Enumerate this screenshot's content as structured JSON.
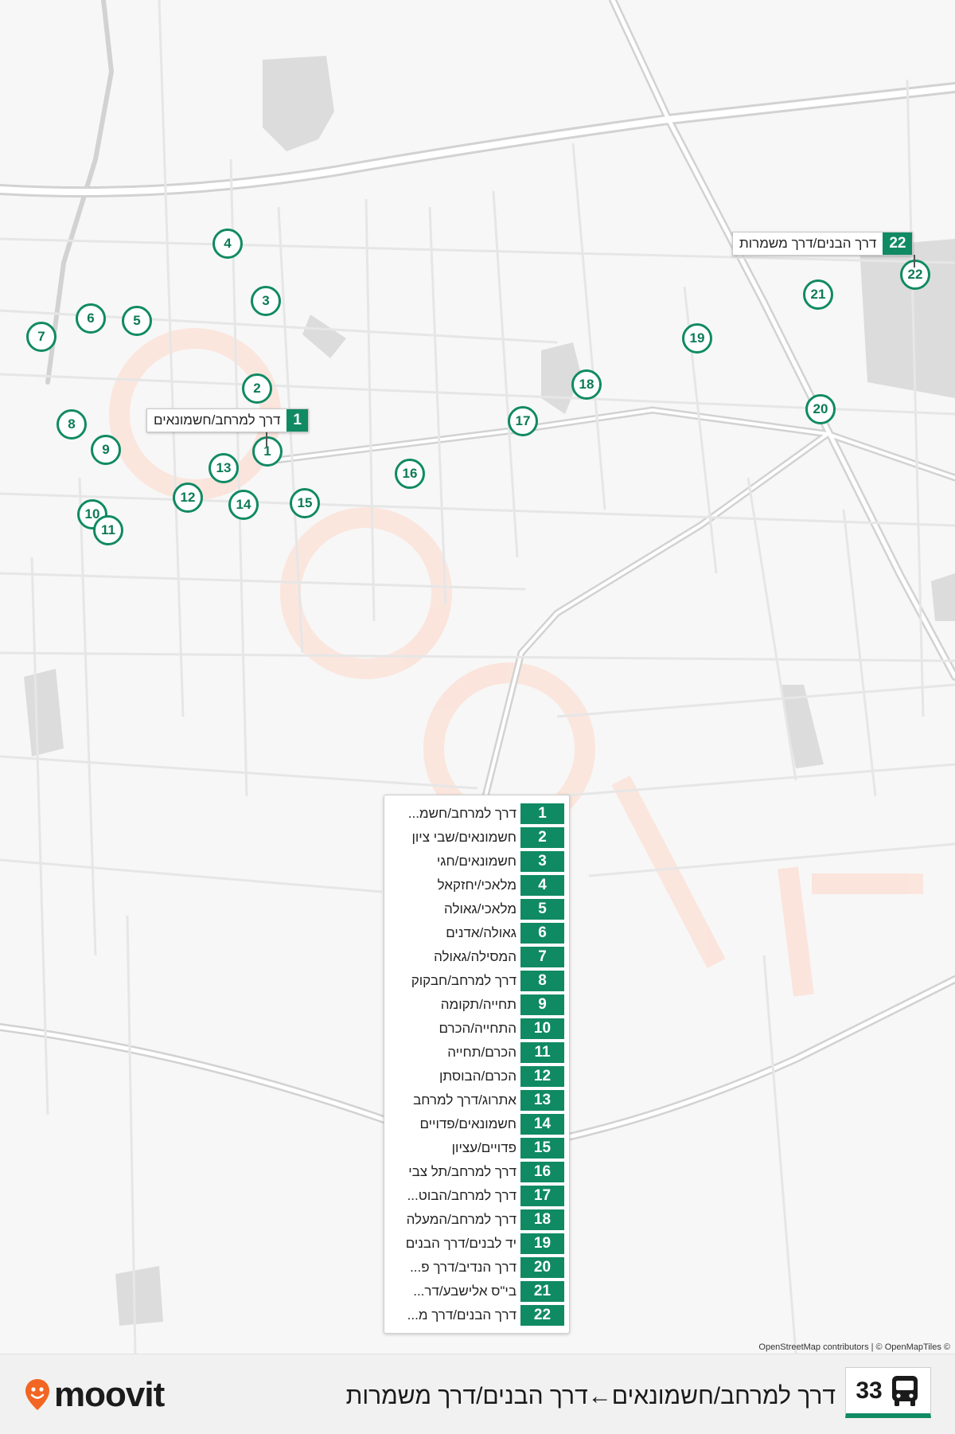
{
  "route": {
    "number": "33",
    "title": "דרך למרחב/חשמונאים←דרך הבנים/דרך משמרות"
  },
  "brand": {
    "name": "moovit",
    "accent": "#108a63",
    "logo_color": "#f26522"
  },
  "attribution": "OpenStreetMap contributors | © OpenMapTiles ©",
  "callouts": {
    "start": {
      "number": "1",
      "name": "דרך למרחב/חשמונאים"
    },
    "end": {
      "number": "22",
      "name": "דרך הבנים/דרך משמרות"
    }
  },
  "stops": [
    {
      "number": "1",
      "name": "דרך למרחב/חשמ..."
    },
    {
      "number": "2",
      "name": "חשמונאים/שבי ציון"
    },
    {
      "number": "3",
      "name": "חשמונאים/חגי"
    },
    {
      "number": "4",
      "name": "מלאכי/יחזקאל"
    },
    {
      "number": "5",
      "name": "מלאכי/גאולה"
    },
    {
      "number": "6",
      "name": "גאולה/אדנים"
    },
    {
      "number": "7",
      "name": "המסילה/גאולה"
    },
    {
      "number": "8",
      "name": "דרך למרחב/חבקוק"
    },
    {
      "number": "9",
      "name": "תחייה/תקומה"
    },
    {
      "number": "10",
      "name": "התחייה/הכרם"
    },
    {
      "number": "11",
      "name": "הכרם/תחייה"
    },
    {
      "number": "12",
      "name": "הכרם/הבוסתן"
    },
    {
      "number": "13",
      "name": "אתרוג/דרך למרחב"
    },
    {
      "number": "14",
      "name": "חשמונאים/פדויים"
    },
    {
      "number": "15",
      "name": "פדויים/עציון"
    },
    {
      "number": "16",
      "name": "דרך למרחב/תל צבי"
    },
    {
      "number": "17",
      "name": "דרך למרחב/הבוט..."
    },
    {
      "number": "18",
      "name": "דרך למרחב/המעלה"
    },
    {
      "number": "19",
      "name": "יד לבנים/דרך הבנים"
    },
    {
      "number": "20",
      "name": "דרך הנדיב/דרך פ..."
    },
    {
      "number": "21",
      "name": "בי\"ס אלישבע/דר..."
    },
    {
      "number": "22",
      "name": "דרך הבנים/דרך מ..."
    }
  ]
}
